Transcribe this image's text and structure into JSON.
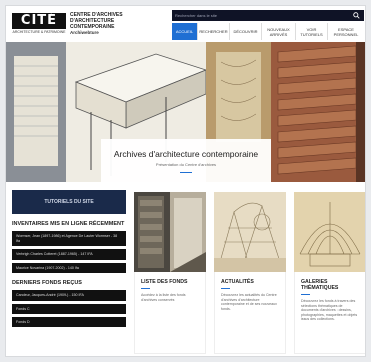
{
  "header": {
    "logo_text": "CITÉ",
    "logo_subtext": "ARCHITECTURE & PATRIMOINE",
    "org_lines": [
      "CENTRE D'ARCHIVES",
      "D'ARCHITECTURE",
      "CONTEMPORAINE"
    ],
    "org_sub": "Archiwebture",
    "search_placeholder": "Rechercher dans le site",
    "menu": [
      {
        "label": "ACCUEIL",
        "active": true
      },
      {
        "label": "RECHERCHER",
        "active": false
      },
      {
        "label": "DÉCOUVRIR",
        "active": false
      },
      {
        "label": "NOUVEAUX ARRIVÉS",
        "active": false
      },
      {
        "label": "VOIR TUTORIELS",
        "active": false
      },
      {
        "label": "ESPACE PERSONNEL",
        "active": false
      }
    ]
  },
  "hero": {
    "title": "Archives d'architecture contemporaine",
    "subtitle": "Présentation du Centre d'archives"
  },
  "left": {
    "tutorials_label": "TUTORIELS DU SITE",
    "inventories_title": "INVENTAIRES MIS EN LIGNE RÉCEMMENT",
    "inventories": [
      "Wormser, Jean (1897-1986) et Agence De Lauter Wormser - 38 Ifa",
      "Verbrigh Charles Cotteret (1887-1965) - 147 IFA",
      "Maurice Novarina (1907-2002) - 140 Ifa"
    ],
    "recent_title": "DERNIERS FONDS REÇUS",
    "recent": [
      "Candeur, Jacques-André (1909-) - 150 IFA",
      "Fonds C",
      "Fonds D"
    ]
  },
  "cards": [
    {
      "title": "LISTE DES FONDS",
      "text": "Accédez à la liste des fonds d'archives conservés"
    },
    {
      "title": "ACTUALITÉS",
      "text": "Découvrez les actualités du Centre d'archives d'architecture contemporaine et de ses nouveaux fonds."
    },
    {
      "title": "GALERIES THÉMATIQUES",
      "text": "Découvrez les fonds à travers des sélections thématiques de documents d'archives : dessins, photographies, maquettes et objets issus des collections."
    }
  ]
}
